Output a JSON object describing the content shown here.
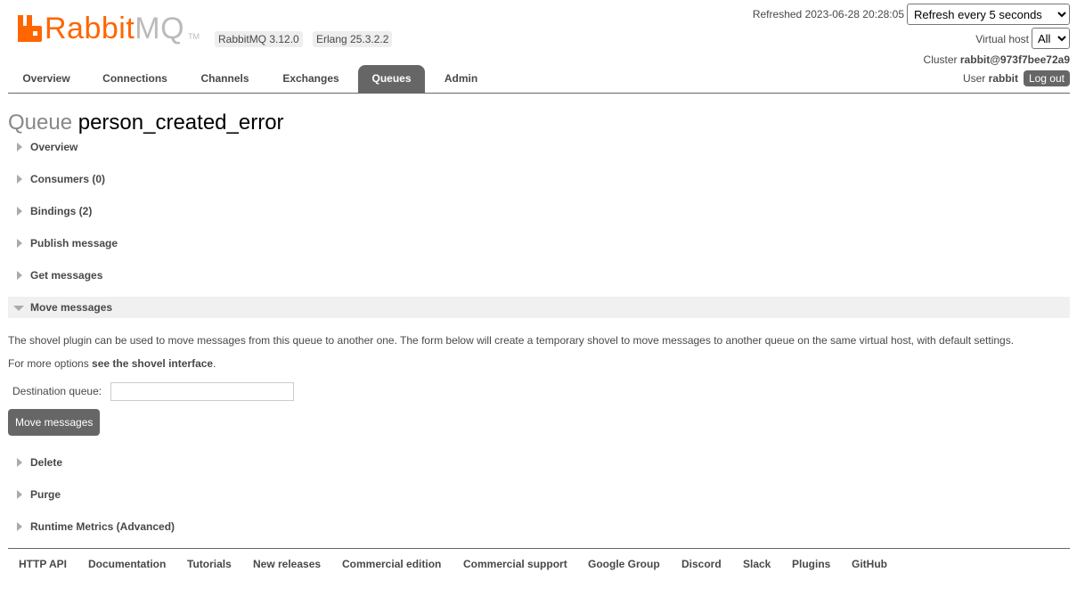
{
  "header": {
    "logo_text_rabbit": "Rabbit",
    "logo_text_mq": "MQ",
    "logo_tm": "TM",
    "rabbitmq_version": "RabbitMQ 3.12.0",
    "erlang_version": "Erlang 25.3.2.2",
    "refreshed_label": "Refreshed",
    "refreshed_time": "2023-06-28 20:28:05",
    "refresh_select_value": "Refresh every 5 seconds",
    "vhost_label": "Virtual host",
    "vhost_value": "All",
    "cluster_label": "Cluster",
    "cluster_name": "rabbit@973f7bee72a9",
    "user_label": "User",
    "user_name": "rabbit",
    "logout_label": "Log out"
  },
  "tabs": [
    {
      "label": "Overview"
    },
    {
      "label": "Connections"
    },
    {
      "label": "Channels"
    },
    {
      "label": "Exchanges"
    },
    {
      "label": "Queues",
      "active": true
    },
    {
      "label": "Admin"
    }
  ],
  "page": {
    "title_prefix": "Queue",
    "queue_name": "person_created_error"
  },
  "sections": [
    {
      "label": "Overview"
    },
    {
      "label": "Consumers (0)"
    },
    {
      "label": "Bindings (2)"
    },
    {
      "label": "Publish message"
    },
    {
      "label": "Get messages"
    },
    {
      "label": "Move messages",
      "open": true
    },
    {
      "label": "Delete"
    },
    {
      "label": "Purge"
    },
    {
      "label": "Runtime Metrics (Advanced)"
    }
  ],
  "move": {
    "description": "The shovel plugin can be used to move messages from this queue to another one. The form below will create a temporary shovel to move messages to another queue on the same virtual host, with default settings.",
    "more_prefix": "For more options",
    "more_link": "see the shovel interface",
    "more_suffix": ".",
    "destination_label": "Destination queue:",
    "destination_value": "",
    "button_label": "Move messages"
  },
  "footer": [
    "HTTP API",
    "Documentation",
    "Tutorials",
    "New releases",
    "Commercial edition",
    "Commercial support",
    "Google Group",
    "Discord",
    "Slack",
    "Plugins",
    "GitHub"
  ],
  "colors": {
    "brand_orange": "#ff6600",
    "tab_active": "#666666"
  }
}
